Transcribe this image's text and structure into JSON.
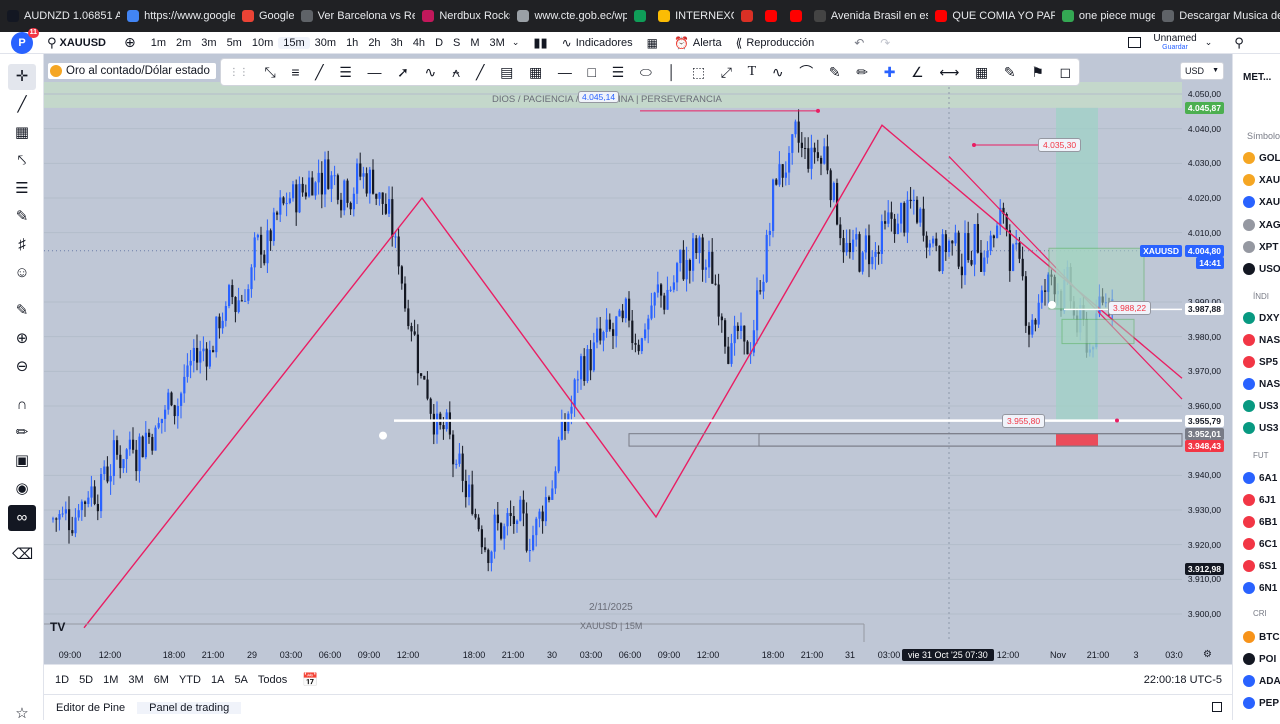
{
  "bookmarks": [
    {
      "label": "AUDNZD 1.06851 A...",
      "color": "#131722"
    },
    {
      "label": "https://www.google...",
      "color": "#4285f4"
    },
    {
      "label": "Google",
      "color": "#ea4335"
    },
    {
      "label": "Ver Barcelona vs Re...",
      "color": "#5f6368"
    },
    {
      "label": "Nerdbux Rocks!",
      "color": "#c2185b"
    },
    {
      "label": "www.cte.gob.ec/wp...",
      "color": "#9aa0a6"
    },
    {
      "label": "",
      "color": "#0f9d58"
    },
    {
      "label": "INTERNEXO",
      "color": "#fbbc04"
    },
    {
      "label": "",
      "color": "#d93025"
    },
    {
      "label": "",
      "color": "#ff0000"
    },
    {
      "label": "",
      "color": "#ff0000"
    },
    {
      "label": "Avenida Brasil en es...",
      "color": "#444"
    },
    {
      "label": "QUE COMIA YO PAR...",
      "color": "#ff0000"
    },
    {
      "label": "one piece mugen",
      "color": "#34a853"
    },
    {
      "label": "Descargar Musica de...",
      "color": "#5f6368"
    }
  ],
  "header": {
    "avatar": "P",
    "notifications": "11",
    "symbol": "XAUUSD",
    "timeframes": [
      "1m",
      "2m",
      "3m",
      "5m",
      "10m",
      "15m",
      "30m",
      "1h",
      "2h",
      "3h",
      "4h",
      "D",
      "S",
      "M",
      "3M"
    ],
    "active_timeframe": "15m",
    "indicators": "Indicadores",
    "alert": "Alerta",
    "replay": "Reproducción",
    "layout_name": "Unnamed",
    "save": "Guardar"
  },
  "chart": {
    "title": "Oro al contado/Dólar estado",
    "currency": "USD",
    "banner_text": "DIOS / PACIENCIA / DISCIPLINA | PERSEVERANCIA",
    "banner_price": "4.045,14",
    "watermark": "XAUUSD | 15M",
    "date_label": "2/11/2025",
    "price_axis": [
      {
        "label": "4.050,00",
        "v": 4050
      },
      {
        "label": "4.040,00",
        "v": 4040
      },
      {
        "label": "4.030,00",
        "v": 4030
      },
      {
        "label": "4.020,00",
        "v": 4020
      },
      {
        "label": "4.010,00",
        "v": 4010
      },
      {
        "label": "3.990,00",
        "v": 3990
      },
      {
        "label": "3.980,00",
        "v": 3980
      },
      {
        "label": "3.970,00",
        "v": 3970
      },
      {
        "label": "3.960,00",
        "v": 3960
      },
      {
        "label": "3.940,00",
        "v": 3940
      },
      {
        "label": "3.930,00",
        "v": 3930
      },
      {
        "label": "3.920,00",
        "v": 3920
      },
      {
        "label": "3.910,00",
        "v": 3910
      },
      {
        "label": "3.900,00",
        "v": 3900
      }
    ],
    "price_tags": [
      {
        "label": "4.045,87",
        "v": 4045.87,
        "bg": "#4caf50",
        "fg": "#ffffff"
      },
      {
        "label": "XAUUSD",
        "v": 4004.8,
        "bg": "#2962ff",
        "fg": "#ffffff"
      },
      {
        "label": "4.004,80",
        "v": 4004.8,
        "bg": "#2962ff",
        "fg": "#ffffff"
      },
      {
        "label": "14:41",
        "v": 4001.3,
        "bg": "#2962ff",
        "fg": "#ffffff"
      },
      {
        "label": "3.987,88",
        "v": 3987.88,
        "bg": "#ffffff",
        "fg": "#131722"
      },
      {
        "label": "3.955,79",
        "v": 3955.79,
        "bg": "#ffffff",
        "fg": "#131722"
      },
      {
        "label": "3.952,01",
        "v": 3952.01,
        "bg": "#787b86",
        "fg": "#ffffff"
      },
      {
        "label": "3.948,43",
        "v": 3948.43,
        "bg": "#f23645",
        "fg": "#ffffff"
      },
      {
        "label": "3.912,98",
        "v": 3912.98,
        "bg": "#131722",
        "fg": "#ffffff"
      }
    ],
    "annotations": [
      {
        "label": "4.035,30",
        "v": 4035.3
      },
      {
        "label": "3.988,22",
        "v": 3988.22
      },
      {
        "label": "3.955,80",
        "v": 3955.8
      }
    ],
    "time_axis": [
      "09:00",
      "12:00",
      "18:00",
      "21:00",
      "29",
      "03:00",
      "06:00",
      "09:00",
      "12:00",
      "18:00",
      "21:00",
      "30",
      "03:00",
      "06:00",
      "09:00",
      "12:00",
      "18:00",
      "21:00",
      "31",
      "03:00",
      "12:00",
      "Nov",
      "21:00",
      "3",
      "03:0"
    ],
    "crosshair_time": "vie 31 Oct '25  07:30",
    "zigzag_prices": [
      3896,
      4020,
      3928,
      4041,
      3968
    ]
  },
  "bottom": {
    "ranges": [
      "1D",
      "5D",
      "1M",
      "3M",
      "6M",
      "YTD",
      "1A",
      "5A",
      "Todos"
    ],
    "clock": "22:00:18 UTC-5"
  },
  "footer": {
    "tabs": [
      "Editor de Pine",
      "Panel de trading"
    ],
    "active": "Panel de trading"
  },
  "watchlist": {
    "title": "MET...",
    "symbols_header": "Símbolo",
    "indices_header": "ÍNDI",
    "futures_header": "FUT",
    "crypto_header": "CRI",
    "items": [
      {
        "label": "GOL",
        "color": "#f5a623"
      },
      {
        "label": "XAU",
        "color": "#f5a623"
      },
      {
        "label": "XAU",
        "color": "#2962ff"
      },
      {
        "label": "XAG",
        "color": "#9598a1"
      },
      {
        "label": "XPT",
        "color": "#9598a1"
      },
      {
        "label": "USO",
        "color": "#131722"
      },
      {
        "label": "DXY",
        "color": "#089981"
      },
      {
        "label": "NAS",
        "color": "#f23645"
      },
      {
        "label": "SP5",
        "color": "#f23645"
      },
      {
        "label": "NAS",
        "color": "#2962ff"
      },
      {
        "label": "US3",
        "color": "#089981"
      },
      {
        "label": "US3",
        "color": "#089981"
      },
      {
        "label": "6A1",
        "color": "#2962ff"
      },
      {
        "label": "6J1",
        "color": "#f23645"
      },
      {
        "label": "6B1",
        "color": "#f23645"
      },
      {
        "label": "6C1",
        "color": "#f23645"
      },
      {
        "label": "6S1",
        "color": "#f23645"
      },
      {
        "label": "6N1",
        "color": "#2962ff"
      },
      {
        "label": "BTC",
        "color": "#f7931a"
      },
      {
        "label": "POI",
        "color": "#131722"
      },
      {
        "label": "ADA",
        "color": "#2962ff"
      },
      {
        "label": "PEP",
        "color": "#2962ff"
      }
    ]
  }
}
